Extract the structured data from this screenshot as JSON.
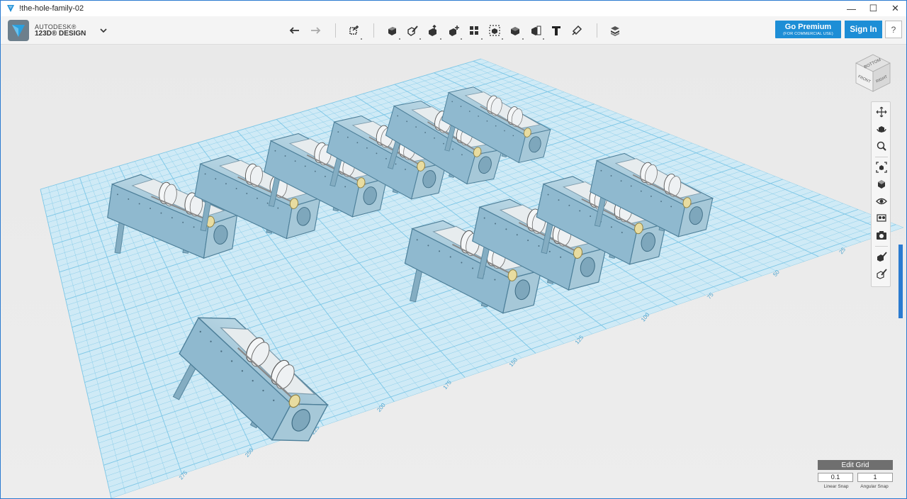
{
  "window": {
    "title": "!the-hole-family-02",
    "controls": {
      "minimize": "—",
      "maximize": "☐",
      "close": "✕"
    }
  },
  "brand": {
    "line1": "AUTODESK®",
    "line2": "123D® DESIGN"
  },
  "toolbar": {
    "icons": [
      "undo-icon",
      "redo-icon",
      "transform-icon",
      "primitives-icon",
      "sketch-icon",
      "construct-icon",
      "modify-icon",
      "pattern-icon",
      "group-icon",
      "combine-icon",
      "measure-icon",
      "text-icon",
      "snap-icon",
      "material-icon"
    ]
  },
  "account": {
    "premium_label": "Go Premium",
    "premium_sub": "(FOR COMMERCIAL USE)",
    "signin_label": "Sign In",
    "help_label": "?"
  },
  "viewcube": {
    "top": "BOTTOM",
    "left": "FRONT",
    "right": "RIGHT"
  },
  "navigation": {
    "items": [
      "pan-icon",
      "orbit-icon",
      "zoom-icon",
      "fit-icon",
      "views-icon",
      "visibility-icon",
      "materials-icon",
      "camera-icon",
      "snap-icon",
      "edit-icon"
    ]
  },
  "grid_ruler": {
    "labels": [
      "25",
      "50",
      "75",
      "100",
      "125",
      "150",
      "175",
      "200",
      "225",
      "250",
      "275"
    ]
  },
  "grid": {
    "edit_label": "Edit Grid",
    "linear_snap_value": "0.1",
    "angular_snap_value": "1",
    "linear_snap_label": "Linear Snap",
    "angular_snap_label": "Angular Snap"
  },
  "colors": {
    "grid_fill": "#cfeaf6",
    "grid_line": "#7cc6e6",
    "model": "#8fb9cf",
    "accent": "#1d8ed6"
  }
}
